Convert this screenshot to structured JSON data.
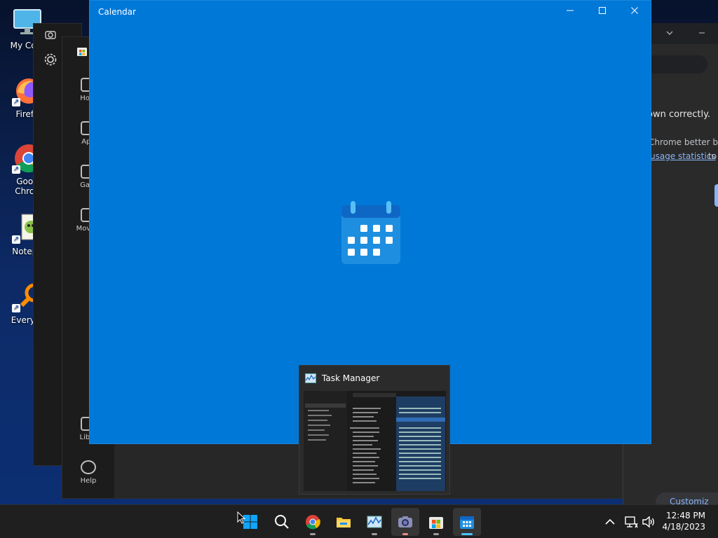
{
  "desktop": {
    "icons": [
      {
        "label": "My Com"
      },
      {
        "label": "Firefo"
      },
      {
        "label": "Goog Chron"
      },
      {
        "label": "Notepa"
      },
      {
        "label": "Everyth"
      }
    ]
  },
  "store_window": {
    "nav": [
      {
        "label": "Hom"
      },
      {
        "label": "App"
      },
      {
        "label": "Gam"
      },
      {
        "label": "Movies"
      },
      {
        "label": "Libra"
      },
      {
        "label": "Help"
      }
    ]
  },
  "chrome_window": {
    "line1": "own correctly.",
    "line2": "Chrome better by",
    "link": "usage statistics",
    "line3_tail": "to",
    "customize": "Customiz"
  },
  "calendar_window": {
    "title": "Calendar",
    "minimize_glyph": "—",
    "maximize_glyph": "☐",
    "close_glyph": "✕",
    "accent_color": "#0078d7"
  },
  "thumbnail": {
    "title": "Task Manager"
  },
  "taskbar": {
    "apps": [
      {
        "name": "start"
      },
      {
        "name": "search"
      },
      {
        "name": "chrome"
      },
      {
        "name": "file-explorer"
      },
      {
        "name": "task-manager"
      },
      {
        "name": "camera"
      },
      {
        "name": "microsoft-store"
      },
      {
        "name": "calendar"
      }
    ],
    "tray": {
      "overflow_glyph": "^"
    },
    "clock": {
      "time": "12:48 PM",
      "date": "4/18/2023"
    }
  }
}
